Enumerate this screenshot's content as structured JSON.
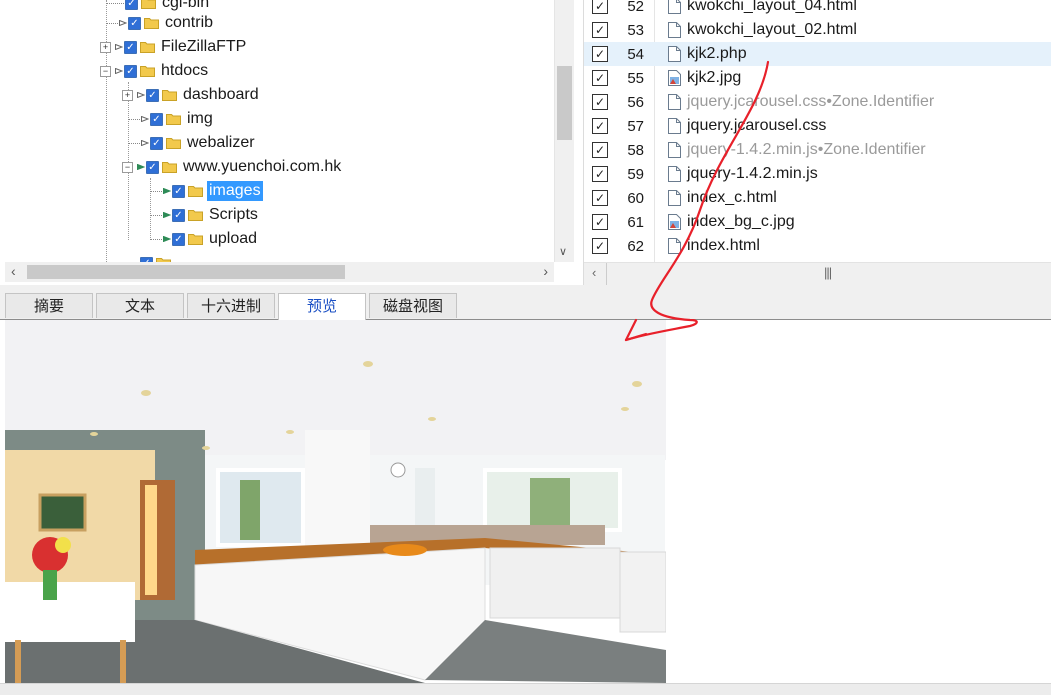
{
  "tree": {
    "items": [
      {
        "label": "cgi-bin"
      },
      {
        "label": "contrib"
      },
      {
        "label": "FileZillaFTP"
      },
      {
        "label": "htdocs"
      },
      {
        "label": "dashboard"
      },
      {
        "label": "img"
      },
      {
        "label": "webalizer"
      },
      {
        "label": "www.yuenchoi.com.hk"
      },
      {
        "label": "images"
      },
      {
        "label": "Scripts"
      },
      {
        "label": "upload"
      }
    ]
  },
  "file_list": {
    "rows": [
      {
        "num": "52",
        "name": "kwokchi_layout_04.html",
        "icon": "html-file-icon"
      },
      {
        "num": "53",
        "name": "kwokchi_layout_02.html",
        "icon": "html-file-icon"
      },
      {
        "num": "54",
        "name": "kjk2.php",
        "icon": "php-file-icon"
      },
      {
        "num": "55",
        "name": "kjk2.jpg",
        "icon": "image-file-icon"
      },
      {
        "num": "56",
        "name": "jquery.jcarousel.css•Zone.Identifier",
        "icon": "file-icon"
      },
      {
        "num": "57",
        "name": "jquery.jcarousel.css",
        "icon": "file-icon"
      },
      {
        "num": "58",
        "name": "jquery-1.4.2.min.js•Zone.Identifier",
        "icon": "file-icon"
      },
      {
        "num": "59",
        "name": "jquery-1.4.2.min.js",
        "icon": "file-icon"
      },
      {
        "num": "60",
        "name": "index_c.html",
        "icon": "html-file-icon"
      },
      {
        "num": "61",
        "name": "index_bg_c.jpg",
        "icon": "image-file-icon"
      },
      {
        "num": "62",
        "name": "index.html",
        "icon": "html-file-icon"
      }
    ]
  },
  "tabs": [
    {
      "label": "摘要"
    },
    {
      "label": "文本"
    },
    {
      "label": "十六进制"
    },
    {
      "label": "预览"
    },
    {
      "label": "磁盘视图"
    }
  ],
  "colors": {
    "selection": "#3399ff",
    "row_highlight": "#e5f1fb",
    "checkbox_blue": "#2f6fd6",
    "active_tab_text": "#1a4fc4",
    "annotation_red": "#e8202a",
    "folder_yellow": "#f2c94c",
    "node_arrow_green": "#2e8b57"
  }
}
